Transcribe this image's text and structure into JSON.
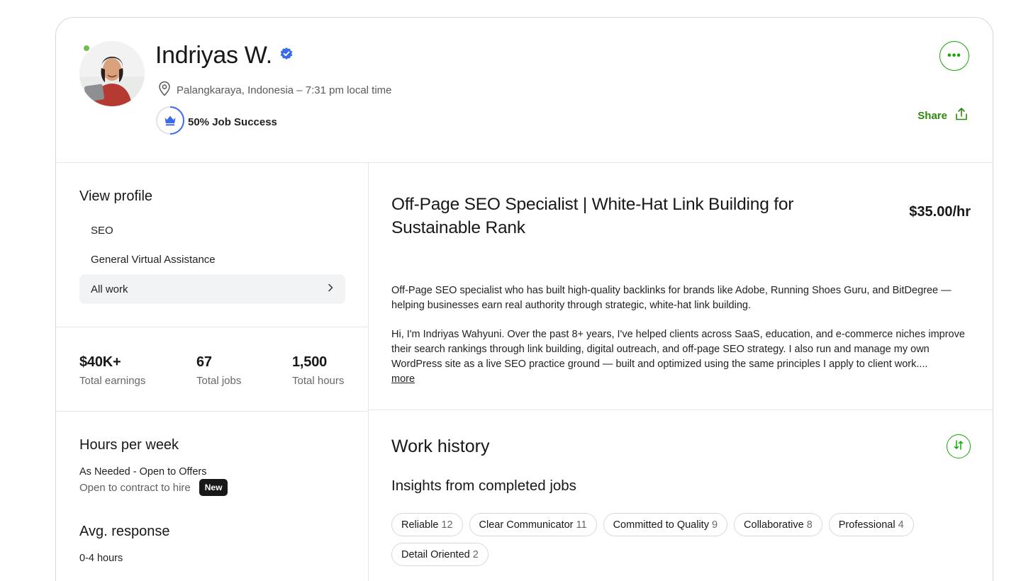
{
  "profile": {
    "name": "Indriyas W.",
    "location": "Palangkaraya, Indonesia – 7:31 pm local time",
    "job_success": "50% Job Success",
    "job_success_pct": 50,
    "share_label": "Share",
    "more_label": "•••"
  },
  "sidebar": {
    "view_profile_title": "View profile",
    "items": [
      {
        "label": "SEO"
      },
      {
        "label": "General Virtual Assistance"
      },
      {
        "label": "All work"
      }
    ]
  },
  "stats": [
    {
      "value": "$40K+",
      "label": "Total earnings"
    },
    {
      "value": "67",
      "label": "Total jobs"
    },
    {
      "value": "1,500",
      "label": "Total hours"
    }
  ],
  "availability": {
    "hours_title": "Hours per week",
    "hours_value": "As Needed - Open to Offers",
    "contract_to_hire": "Open to contract to hire",
    "new_badge": "New",
    "response_title": "Avg. response",
    "response_value": "0-4 hours"
  },
  "job": {
    "title": "Off-Page SEO Specialist | White-Hat Link Building for Sustainable Rank",
    "rate": "$35.00/hr",
    "overview_p1": "Off-Page SEO specialist who has built high-quality backlinks for brands like Adobe, Running Shoes Guru, and BitDegree — helping businesses earn real authority through strategic, white-hat link building.",
    "overview_p2": "Hi, I'm Indriyas Wahyuni. Over the past 8+ years, I've helped clients across SaaS, education, and e-commerce niches improve their search rankings through link building, digital outreach, and off-page SEO strategy. I also run and manage my own WordPress site as a live SEO practice ground — built and optimized using the same principles I apply to client work....",
    "more_link": "more"
  },
  "work_history": {
    "title": "Work history",
    "insights_title": "Insights from completed jobs",
    "chips": [
      {
        "label": "Reliable",
        "count": "12"
      },
      {
        "label": "Clear Communicator",
        "count": "11"
      },
      {
        "label": "Committed to Quality",
        "count": "9"
      },
      {
        "label": "Collaborative",
        "count": "8"
      },
      {
        "label": "Professional",
        "count": "4"
      },
      {
        "label": "Detail Oriented",
        "count": "2"
      }
    ]
  },
  "colors": {
    "accent_green": "#14a800",
    "verified_blue": "#3b6be8",
    "online_green": "#6fbf4a"
  },
  "icons": [
    "verified-badge-icon",
    "location-pin-icon",
    "crown-icon",
    "more-icon",
    "share-icon",
    "chevron-right-icon",
    "sort-icon"
  ]
}
